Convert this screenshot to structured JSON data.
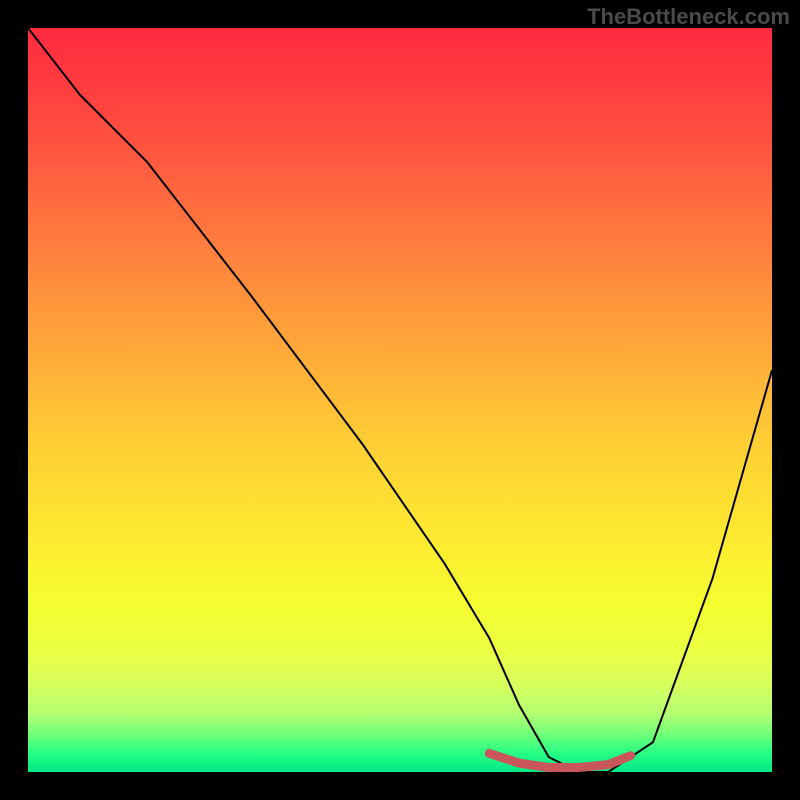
{
  "watermark": "TheBottleneck.com",
  "chart_data": {
    "type": "line",
    "title": "",
    "xlabel": "",
    "ylabel": "",
    "xlim": [
      0,
      100
    ],
    "ylim": [
      0,
      100
    ],
    "grid": false,
    "series": [
      {
        "name": "main-curve",
        "x": [
          0,
          7,
          16,
          30,
          45,
          56,
          62,
          66,
          70,
          74,
          78,
          84,
          92,
          100
        ],
        "y": [
          100,
          91,
          82,
          64,
          44,
          28,
          18,
          9,
          2,
          0,
          0,
          4,
          26,
          54
        ]
      },
      {
        "name": "bottom-highlight",
        "x": [
          62,
          66,
          70,
          74,
          78,
          81
        ],
        "y": [
          2.5,
          1.2,
          0.6,
          0.6,
          1.0,
          2.2
        ]
      }
    ],
    "note": "Values are read from a plot with no axes; x and y are normalized to 0-100 where y=0 is the bottom (green) and y=100 is the top (red)."
  }
}
